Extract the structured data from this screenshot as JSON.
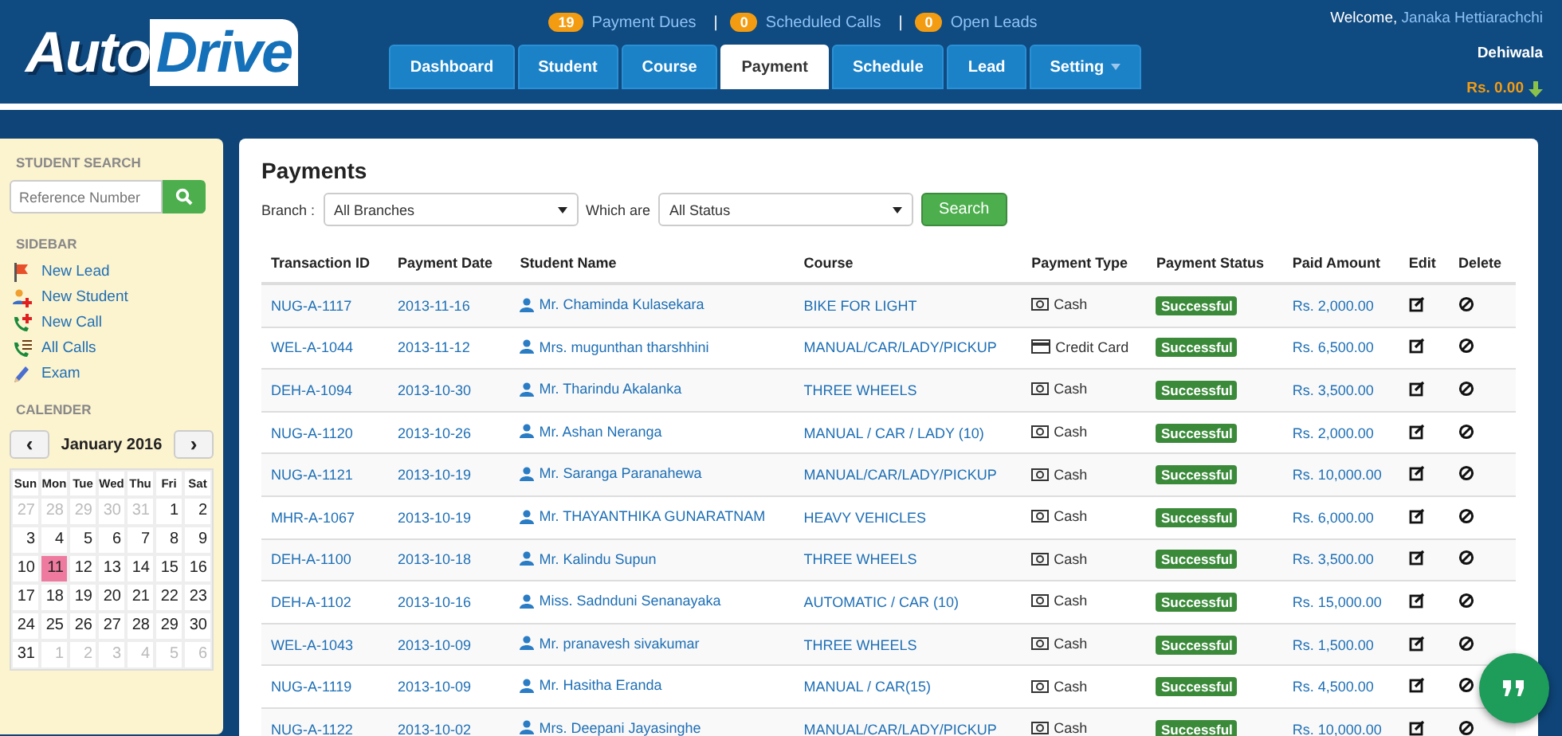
{
  "logo": {
    "part_1": "Auto",
    "part_2": "Drive"
  },
  "counters": [
    {
      "count": "19",
      "label": "Payment Dues"
    },
    {
      "count": "0",
      "label": "Scheduled Calls"
    },
    {
      "count": "0",
      "label": "Open Leads"
    }
  ],
  "separator": "|",
  "user": {
    "greeting": "Welcome,",
    "name": "Janaka Hettiarachchi",
    "branch": "Dehiwala",
    "balance": "Rs. 0.00"
  },
  "tabs": [
    {
      "label": "Dashboard",
      "selected": false
    },
    {
      "label": "Student",
      "selected": false
    },
    {
      "label": "Course",
      "selected": false
    },
    {
      "label": "Payment",
      "selected": true
    },
    {
      "label": "Schedule",
      "selected": false
    },
    {
      "label": "Lead",
      "selected": false
    },
    {
      "label": "Setting",
      "selected": false,
      "dropdown": true
    }
  ],
  "sidebar": {
    "search_title": "STUDENT SEARCH",
    "search_placeholder": "Reference Number",
    "links_title": "SIDEBAR",
    "links": [
      {
        "kind": "flag",
        "label": "New Lead"
      },
      {
        "kind": "student",
        "label": "New Student"
      },
      {
        "kind": "call",
        "label": "New Call"
      },
      {
        "kind": "calls",
        "label": "All Calls"
      },
      {
        "kind": "pencil",
        "label": "Exam"
      }
    ],
    "calendar_title": "CALENDER",
    "month": "January 2016",
    "prev": "‹",
    "next": "›",
    "weekdays": [
      "Sun",
      "Mon",
      "Tue",
      "Wed",
      "Thu",
      "Fri",
      "Sat"
    ],
    "days": [
      {
        "day": "27",
        "other_month": true,
        "selected": false
      },
      {
        "day": "28",
        "other_month": true,
        "selected": false
      },
      {
        "day": "29",
        "other_month": true,
        "selected": false
      },
      {
        "day": "30",
        "other_month": true,
        "selected": false
      },
      {
        "day": "31",
        "other_month": true,
        "selected": false
      },
      {
        "day": "1",
        "other_month": false,
        "selected": false
      },
      {
        "day": "2",
        "other_month": false,
        "selected": false
      },
      {
        "day": "3",
        "other_month": false,
        "selected": false
      },
      {
        "day": "4",
        "other_month": false,
        "selected": false
      },
      {
        "day": "5",
        "other_month": false,
        "selected": false
      },
      {
        "day": "6",
        "other_month": false,
        "selected": false
      },
      {
        "day": "7",
        "other_month": false,
        "selected": false
      },
      {
        "day": "8",
        "other_month": false,
        "selected": false
      },
      {
        "day": "9",
        "other_month": false,
        "selected": false
      },
      {
        "day": "10",
        "other_month": false,
        "selected": false
      },
      {
        "day": "11",
        "other_month": false,
        "selected": true
      },
      {
        "day": "12",
        "other_month": false,
        "selected": false
      },
      {
        "day": "13",
        "other_month": false,
        "selected": false
      },
      {
        "day": "14",
        "other_month": false,
        "selected": false
      },
      {
        "day": "15",
        "other_month": false,
        "selected": false
      },
      {
        "day": "16",
        "other_month": false,
        "selected": false
      },
      {
        "day": "17",
        "other_month": false,
        "selected": false
      },
      {
        "day": "18",
        "other_month": false,
        "selected": false
      },
      {
        "day": "19",
        "other_month": false,
        "selected": false
      },
      {
        "day": "20",
        "other_month": false,
        "selected": false
      },
      {
        "day": "21",
        "other_month": false,
        "selected": false
      },
      {
        "day": "22",
        "other_month": false,
        "selected": false
      },
      {
        "day": "23",
        "other_month": false,
        "selected": false
      },
      {
        "day": "24",
        "other_month": false,
        "selected": false
      },
      {
        "day": "25",
        "other_month": false,
        "selected": false
      },
      {
        "day": "26",
        "other_month": false,
        "selected": false
      },
      {
        "day": "27",
        "other_month": false,
        "selected": false
      },
      {
        "day": "28",
        "other_month": false,
        "selected": false
      },
      {
        "day": "29",
        "other_month": false,
        "selected": false
      },
      {
        "day": "30",
        "other_month": false,
        "selected": false
      },
      {
        "day": "31",
        "other_month": false,
        "selected": false
      },
      {
        "day": "1",
        "other_month": true,
        "selected": false
      },
      {
        "day": "2",
        "other_month": true,
        "selected": false
      },
      {
        "day": "3",
        "other_month": true,
        "selected": false
      },
      {
        "day": "4",
        "other_month": true,
        "selected": false
      },
      {
        "day": "5",
        "other_month": true,
        "selected": false
      },
      {
        "day": "6",
        "other_month": true,
        "selected": false
      }
    ]
  },
  "payments": {
    "title": "Payments",
    "branch_label": "Branch :",
    "branch_value": "All Branches",
    "status_label": "Which are",
    "status_value": "All Status",
    "search_button": "Search",
    "columns": [
      "Transaction ID",
      "Payment Date",
      "Student Name",
      "Course",
      "Payment Type",
      "Payment Status",
      "Paid Amount",
      "Edit",
      "Delete"
    ],
    "rows": [
      {
        "id": "NUG-A-1117",
        "date": "2013-11-16",
        "student": "Mr. Chaminda Kulasekara",
        "course": "BIKE FOR LIGHT",
        "kind": "cash",
        "type": "Cash",
        "status": "Successful",
        "amount": "Rs. 2,000.00"
      },
      {
        "id": "WEL-A-1044",
        "date": "2013-11-12",
        "student": "Mrs. mugunthan tharshhini",
        "course": "MANUAL/CAR/LADY/PICKUP",
        "kind": "card",
        "type": "Credit Card",
        "status": "Successful",
        "amount": "Rs. 6,500.00"
      },
      {
        "id": "DEH-A-1094",
        "date": "2013-10-30",
        "student": "Mr. Tharindu Akalanka",
        "course": "THREE WHEELS",
        "kind": "cash",
        "type": "Cash",
        "status": "Successful",
        "amount": "Rs. 3,500.00"
      },
      {
        "id": "NUG-A-1120",
        "date": "2013-10-26",
        "student": "Mr. Ashan Neranga",
        "course": "MANUAL / CAR / LADY (10)",
        "kind": "cash",
        "type": "Cash",
        "status": "Successful",
        "amount": "Rs. 2,000.00"
      },
      {
        "id": "NUG-A-1121",
        "date": "2013-10-19",
        "student": "Mr. Saranga Paranahewa",
        "course": "MANUAL/CAR/LADY/PICKUP",
        "kind": "cash",
        "type": "Cash",
        "status": "Successful",
        "amount": "Rs. 10,000.00"
      },
      {
        "id": "MHR-A-1067",
        "date": "2013-10-19",
        "student": "Mr. THAYANTHIKA GUNARATNAM",
        "course": "HEAVY VEHICLES",
        "kind": "cash",
        "type": "Cash",
        "status": "Successful",
        "amount": "Rs. 6,000.00"
      },
      {
        "id": "DEH-A-1100",
        "date": "2013-10-18",
        "student": "Mr. Kalindu Supun",
        "course": "THREE WHEELS",
        "kind": "cash",
        "type": "Cash",
        "status": "Successful",
        "amount": "Rs. 3,500.00"
      },
      {
        "id": "DEH-A-1102",
        "date": "2013-10-16",
        "student": "Miss. Sadnduni Senanayaka",
        "course": "AUTOMATIC / CAR (10)",
        "kind": "cash",
        "type": "Cash",
        "status": "Successful",
        "amount": "Rs. 15,000.00"
      },
      {
        "id": "WEL-A-1043",
        "date": "2013-10-09",
        "student": "Mr. pranavesh sivakumar",
        "course": "THREE WHEELS",
        "kind": "cash",
        "type": "Cash",
        "status": "Successful",
        "amount": "Rs. 1,500.00"
      },
      {
        "id": "NUG-A-1119",
        "date": "2013-10-09",
        "student": "Mr. Hasitha Eranda",
        "course": "MANUAL / CAR(15)",
        "kind": "cash",
        "type": "Cash",
        "status": "Successful",
        "amount": "Rs. 4,500.00"
      },
      {
        "id": "NUG-A-1122",
        "date": "2013-10-02",
        "student": "Mrs. Deepani Jayasinghe",
        "course": "MANUAL/CAR/LADY/PICKUP",
        "kind": "cash",
        "type": "Cash",
        "status": "Successful",
        "amount": "Rs. 10,000.00"
      }
    ]
  }
}
